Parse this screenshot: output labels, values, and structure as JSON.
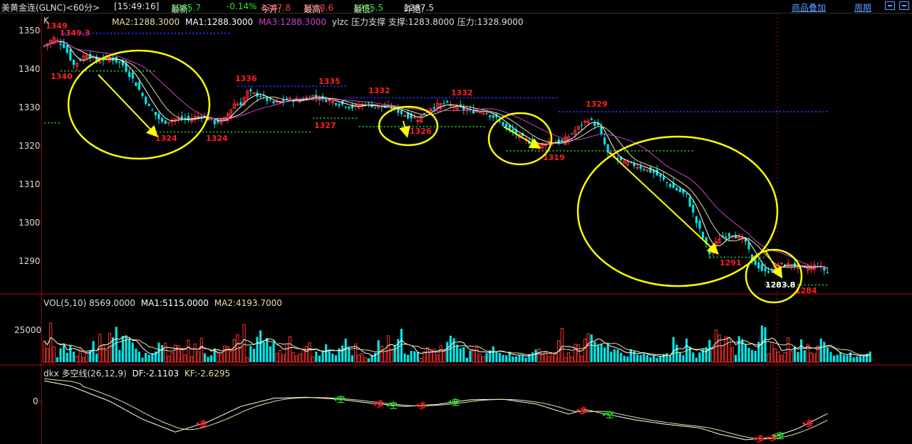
{
  "header": {
    "title": "美黄金连(GLNC)<60分>",
    "time": "[15:49:16]",
    "latest_label": "最新:",
    "latest": "1285.7",
    "change": "-0.14%",
    "open_label": "今开:",
    "open": "1287.8",
    "high_label": "最高:",
    "high": "1290.6",
    "low_label": "最低:",
    "low": "1285.5",
    "prev_label": "昨结:",
    "prev": "1287.5",
    "overlay_link": "商品叠加",
    "period_link": "周期"
  },
  "colors": {
    "bull": "#ff3030",
    "bear": "#00e5e5",
    "ma1": "#ffffff",
    "ma2": "#e8e0a0",
    "ma3": "#d040d0",
    "annotation": "#ffff00",
    "support": "#22aa22",
    "resistance": "#2233ff",
    "price_label": "#ff2020"
  },
  "price_panel": {
    "legend": {
      "k": "K",
      "ma2": "MA2:1288.3000",
      "ma1": "MA1:1288.3000",
      "ma3": "MA3:1288.3000",
      "ylzc": "ylzc 压力支撑 支撑:1283.8000 压力:1328.9000"
    },
    "y_ticks": [
      "1350",
      "1340",
      "1330",
      "1320",
      "1310",
      "1300",
      "1290"
    ],
    "price_labels": [
      "1349",
      "1349.3",
      "1340",
      "1324",
      "1324",
      "1336",
      "1327",
      "1335",
      "1332",
      "1326",
      "1332",
      "1319",
      "1329",
      "1291",
      "1283.8",
      "1284"
    ]
  },
  "volume_panel": {
    "legend": {
      "name": "VOL(5,10) 8569.0000",
      "ma1": "MA1:5115.0000",
      "ma2": "MA2:4193.7000"
    },
    "y_ticks": [
      "25000"
    ]
  },
  "dkx_panel": {
    "legend": {
      "name": "dkx 多空线(26,12,9)",
      "df": "DF:-2.1103",
      "kf": "KF:-2.6295"
    },
    "y_ticks": [
      "0"
    ],
    "buy_label": "多",
    "sell_label": "空"
  },
  "chart_data": {
    "type": "candlestick",
    "ylim": [
      1281,
      1352
    ],
    "anchors": [
      [
        0,
        1346
      ],
      [
        3,
        1348
      ],
      [
        6,
        1346
      ],
      [
        9,
        1341
      ],
      [
        13,
        1344
      ],
      [
        16,
        1342
      ],
      [
        20,
        1343
      ],
      [
        24,
        1341
      ],
      [
        28,
        1336
      ],
      [
        32,
        1330
      ],
      [
        36,
        1326
      ],
      [
        40,
        1327
      ],
      [
        44,
        1327
      ],
      [
        48,
        1328
      ],
      [
        52,
        1326
      ],
      [
        55,
        1327
      ],
      [
        58,
        1331
      ],
      [
        60,
        1331
      ],
      [
        62,
        1334
      ],
      [
        66,
        1333
      ],
      [
        70,
        1331
      ],
      [
        74,
        1332
      ],
      [
        78,
        1332
      ],
      [
        82,
        1333
      ],
      [
        86,
        1332
      ],
      [
        90,
        1331
      ],
      [
        94,
        1330
      ],
      [
        98,
        1331
      ],
      [
        102,
        1330
      ],
      [
        106,
        1330
      ],
      [
        110,
        1328
      ],
      [
        114,
        1327
      ],
      [
        118,
        1330
      ],
      [
        122,
        1331
      ],
      [
        126,
        1330
      ],
      [
        130,
        1329
      ],
      [
        134,
        1329
      ],
      [
        138,
        1327
      ],
      [
        142,
        1324
      ],
      [
        146,
        1322
      ],
      [
        150,
        1320
      ],
      [
        154,
        1321
      ],
      [
        158,
        1321
      ],
      [
        162,
        1324
      ],
      [
        166,
        1327
      ],
      [
        169,
        1325
      ],
      [
        172,
        1318
      ],
      [
        176,
        1316
      ],
      [
        180,
        1315
      ],
      [
        186,
        1313
      ],
      [
        192,
        1309
      ],
      [
        196,
        1307
      ],
      [
        199,
        1300
      ],
      [
        203,
        1292
      ],
      [
        206,
        1296
      ],
      [
        210,
        1297
      ],
      [
        214,
        1295
      ],
      [
        216,
        1290
      ],
      [
        220,
        1287
      ],
      [
        224,
        1289
      ],
      [
        228,
        1289
      ],
      [
        232,
        1288
      ],
      [
        236,
        1289
      ],
      [
        239,
        1287
      ]
    ],
    "volume_ylim": [
      0,
      14000
    ],
    "volume": [
      5200,
      3400,
      9600,
      3800,
      1200,
      3400,
      4600,
      2300,
      4200,
      2600,
      1500,
      3400,
      1200,
      2400,
      3000,
      5200,
      2100,
      6900,
      4200,
      2900,
      7100,
      6100,
      8700,
      3000,
      6400,
      6600,
      5700,
      4800,
      3300,
      2600,
      1100,
      2300,
      1800,
      2200,
      2600,
      4800,
      4200,
      4700,
      1500,
      2300,
      4200,
      4100,
      3200,
      1800,
      5400,
      1400,
      4500,
      2600,
      5900,
      2200,
      1300,
      1700,
      3400,
      3000,
      1900,
      4000,
      3900,
      2700,
      5600,
      6800,
      3500,
      9300,
      1200,
      4000,
      3300,
      6200,
      7800,
      5000,
      5900,
      3900,
      4900,
      2200,
      2900,
      1900,
      4500,
      6300,
      2400,
      1600,
      2000,
      3200,
      3900,
      4800,
      1300,
      2600,
      1600,
      2900,
      4400,
      3100,
      2100,
      1700,
      3400,
      4100,
      5800,
      3600,
      1700,
      4500,
      1800,
      2100,
      1100,
      900,
      1800,
      2300,
      5400,
      4000,
      2600,
      6500,
      3200,
      4100,
      5700,
      8200,
      2100,
      1800,
      2800,
      2700,
      2500,
      1000,
      2600,
      3600,
      2600,
      3200,
      1800,
      4100,
      3000,
      5000,
      6500,
      5900,
      4300,
      3400,
      3700,
      1100,
      2800,
      3200,
      3600,
      1900,
      1400,
      2200,
      2900,
      3900,
      2600,
      2300,
      1800,
      1700,
      2600,
      1400,
      1400,
      1800,
      1700,
      1100,
      2000,
      2400,
      3100,
      3300,
      1900,
      2500,
      1400,
      2200,
      2400,
      5300,
      8300,
      1100,
      2400,
      1300,
      4400,
      4300,
      1500,
      5700,
      7000,
      6800,
      5000,
      4200,
      4500,
      3600,
      4500,
      2600,
      3200,
      3100,
      2300,
      1600,
      1400,
      3200,
      2700,
      1900,
      1800,
      2200,
      1800,
      1200,
      1600,
      1100,
      1500,
      2000,
      2200,
      1600,
      6200,
      4300,
      2400,
      1700,
      5800,
      3800,
      2400,
      1100,
      2400,
      3300,
      3700,
      5500,
      3400,
      7900,
      6700,
      4000,
      6300,
      5900,
      3600,
      1800,
      6400,
      5700,
      4500,
      3500,
      3000,
      2800,
      5000,
      9000,
      8600,
      2100,
      4900,
      3300,
      2500,
      1700,
      2400,
      6000,
      2700,
      3800,
      2500,
      5600,
      2900,
      4400,
      2300,
      2100,
      4000,
      5800,
      5000,
      3600,
      2500,
      1600,
      1800,
      2400,
      1800,
      1700,
      2400,
      1200,
      1400,
      1500,
      1600,
      2100,
      2600
    ],
    "dkx_ylim": [
      -9,
      5
    ],
    "dkx_anchors": [
      [
        0,
        4
      ],
      [
        8,
        3
      ],
      [
        20,
        0
      ],
      [
        30,
        -3.5
      ],
      [
        40,
        -6
      ],
      [
        50,
        -4
      ],
      [
        60,
        -1
      ],
      [
        70,
        0.6
      ],
      [
        80,
        0.8
      ],
      [
        90,
        0.4
      ],
      [
        100,
        -0.4
      ],
      [
        110,
        -1
      ],
      [
        120,
        -0.6
      ],
      [
        130,
        0.3
      ],
      [
        140,
        0.4
      ],
      [
        150,
        -0.5
      ],
      [
        160,
        -2.5
      ],
      [
        165,
        -1.6
      ],
      [
        170,
        -2.3
      ],
      [
        180,
        -3.6
      ],
      [
        190,
        -4.5
      ],
      [
        200,
        -5.2
      ],
      [
        206,
        -6.4
      ],
      [
        214,
        -7.5
      ],
      [
        222,
        -7.1
      ],
      [
        230,
        -5.3
      ],
      [
        239,
        -2.4
      ]
    ],
    "signals": [
      [
        48,
        "buy"
      ],
      [
        90,
        "sell"
      ],
      [
        102,
        "buy"
      ],
      [
        106,
        "sell"
      ],
      [
        115,
        "buy"
      ],
      [
        125,
        "sell"
      ],
      [
        164,
        "buy"
      ],
      [
        172,
        "sell"
      ],
      [
        218,
        "buy"
      ],
      [
        222,
        "buy"
      ],
      [
        224,
        "sell"
      ],
      [
        233,
        "buy"
      ]
    ],
    "support_lines": [
      {
        "y": 1326,
        "from": 0,
        "to": 5
      },
      {
        "y": 1339.5,
        "from": 5,
        "to": 34
      },
      {
        "y": 1323.6,
        "from": 33,
        "to": 82
      },
      {
        "y": 1327.2,
        "from": 82,
        "to": 96
      },
      {
        "y": 1325,
        "from": 96,
        "to": 135
      },
      {
        "y": 1318.7,
        "from": 141,
        "to": 198
      },
      {
        "y": 1291,
        "from": 203,
        "to": 220
      },
      {
        "y": 1283.8,
        "from": 220,
        "to": 239
      }
    ],
    "resistance_lines": [
      {
        "y": 1349.3,
        "from": 5,
        "to": 57
      },
      {
        "y": 1335.5,
        "from": 59,
        "to": 92
      },
      {
        "y": 1332.5,
        "from": 92,
        "to": 157
      },
      {
        "y": 1328.9,
        "from": 157,
        "to": 239
      }
    ],
    "ellipses": [
      {
        "cx": 195,
        "cy": 147,
        "rx": 99,
        "ry": 76
      },
      {
        "cx": 573,
        "cy": 177,
        "rx": 41,
        "ry": 27
      },
      {
        "cx": 730,
        "cy": 195,
        "rx": 44,
        "ry": 36
      },
      {
        "cx": 951,
        "cy": 297,
        "rx": 140,
        "ry": 105
      },
      {
        "cx": 1086,
        "cy": 388,
        "rx": 39,
        "ry": 37
      }
    ],
    "arrows": [
      [
        138,
        105,
        219,
        190
      ],
      [
        566,
        170,
        571,
        190
      ],
      [
        707,
        178,
        756,
        207
      ],
      [
        855,
        214,
        1006,
        355
      ],
      [
        1074,
        352,
        1096,
        388
      ]
    ]
  }
}
